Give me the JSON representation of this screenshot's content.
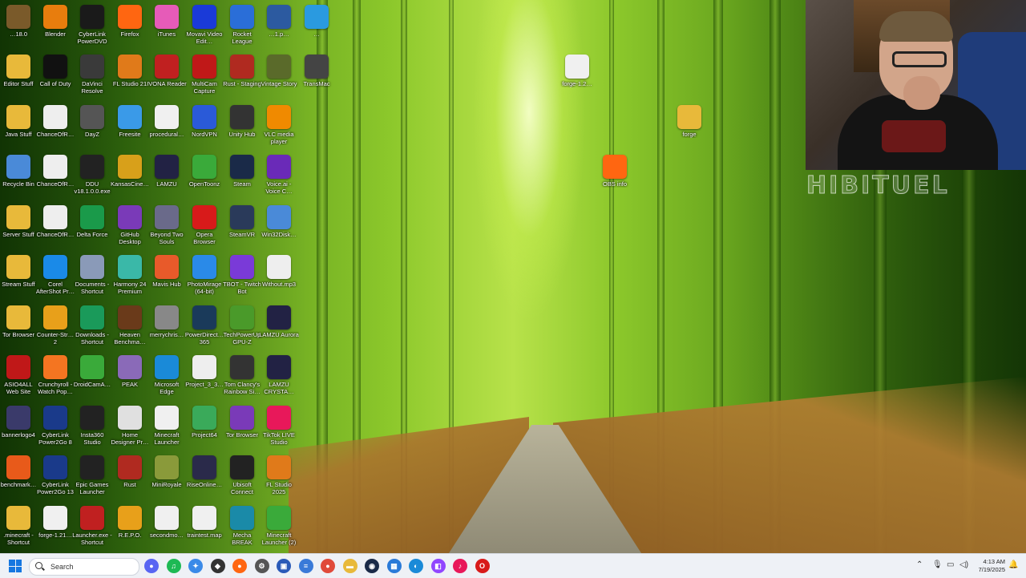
{
  "desktop_icons": [
    {
      "label": "…18.0",
      "icon": "app-icon",
      "color": "#7a5a2a"
    },
    {
      "label": "Blender",
      "icon": "blender-icon",
      "color": "#e87d0d"
    },
    {
      "label": "CyberLink PowerDVD",
      "icon": "powerdvd-icon",
      "color": "#1a1a1a"
    },
    {
      "label": "Firefox",
      "icon": "firefox-icon",
      "color": "#ff6611"
    },
    {
      "label": "iTunes",
      "icon": "itunes-icon",
      "color": "#e65bb8"
    },
    {
      "label": "Movavi Video Edit…",
      "icon": "movavi-icon",
      "color": "#1a3ad8"
    },
    {
      "label": "Rocket League",
      "icon": "rocket-league-icon",
      "color": "#2a6ed8"
    },
    {
      "label": "…1.p…",
      "icon": "document-icon",
      "color": "#2c5aa0"
    },
    {
      "label": "…",
      "icon": "app-icon",
      "color": "#2a9ae0"
    },
    {
      "label": "Editor Stuff",
      "icon": "folder-icon",
      "color": "#e8b93a"
    },
    {
      "label": "Call of Duty",
      "icon": "cod-icon",
      "color": "#111111"
    },
    {
      "label": "DaVinci Resolve",
      "icon": "davinci-icon",
      "color": "#3a3a3a"
    },
    {
      "label": "FL Studio 21",
      "icon": "fl-studio-icon",
      "color": "#e07a1a"
    },
    {
      "label": "IVONA Reader",
      "icon": "ivona-icon",
      "color": "#c02020"
    },
    {
      "label": "MultiCam Capture",
      "icon": "multicam-icon",
      "color": "#c01818"
    },
    {
      "label": "Rust - Staging",
      "icon": "rust-icon",
      "color": "#b02a20"
    },
    {
      "label": "Vintage Story",
      "icon": "vintage-story-icon",
      "color": "#5a6a2a"
    },
    {
      "label": "TransMac",
      "icon": "transmac-icon",
      "color": "#444444"
    },
    {
      "label": "Java Stuff",
      "icon": "folder-icon",
      "color": "#e8b93a"
    },
    {
      "label": "ChanceOfR…",
      "icon": "media-file-icon",
      "color": "#eeeeee"
    },
    {
      "label": "DayZ",
      "icon": "dayz-icon",
      "color": "#555555"
    },
    {
      "label": "Freesite",
      "icon": "freesite-icon",
      "color": "#3a9ae8"
    },
    {
      "label": "procedural…",
      "icon": "document-icon",
      "color": "#f0f0f0"
    },
    {
      "label": "NordVPN",
      "icon": "nordvpn-icon",
      "color": "#2a5ad8"
    },
    {
      "label": "Unity Hub",
      "icon": "unity-icon",
      "color": "#333333"
    },
    {
      "label": "VLC media player",
      "icon": "vlc-icon",
      "color": "#f08a00"
    },
    {
      "label": "Recycle Bin",
      "icon": "recycle-bin-icon",
      "color": "#4a8ad8"
    },
    {
      "label": "ChanceOfR…",
      "icon": "media-file-icon",
      "color": "#eeeeee"
    },
    {
      "label": "DDU v18.1.0.0.exe",
      "icon": "ddu-icon",
      "color": "#222222"
    },
    {
      "label": "KansasCine…",
      "icon": "app-icon",
      "color": "#d8a01a"
    },
    {
      "label": "LAMZU",
      "icon": "lamzu-icon",
      "color": "#222244"
    },
    {
      "label": "OpenToonz",
      "icon": "opentoonz-icon",
      "color": "#3aaa3a"
    },
    {
      "label": "Steam",
      "icon": "steam-icon",
      "color": "#1a2a48"
    },
    {
      "label": "Voice.ai - Voice C…",
      "icon": "voiceai-icon",
      "color": "#6a2ab8"
    },
    {
      "label": "Server Stuff",
      "icon": "folder-icon",
      "color": "#e8b93a"
    },
    {
      "label": "ChanceOfR…",
      "icon": "media-file-icon",
      "color": "#eeeeee"
    },
    {
      "label": "Delta Force",
      "icon": "delta-force-icon",
      "color": "#1a9a4a"
    },
    {
      "label": "GitHub Desktop",
      "icon": "github-icon",
      "color": "#7a3ab8"
    },
    {
      "label": "Beyond Two Souls",
      "icon": "game-icon",
      "color": "#6a6a8a"
    },
    {
      "label": "Opera Browser",
      "icon": "opera-icon",
      "color": "#d81a1a"
    },
    {
      "label": "SteamVR",
      "icon": "steamvr-icon",
      "color": "#2a3a5a"
    },
    {
      "label": "Win32Disk…",
      "icon": "win32disk-icon",
      "color": "#4a8ad8"
    },
    {
      "label": "Stream Stuff",
      "icon": "folder-icon",
      "color": "#e8b93a"
    },
    {
      "label": "Corel AfterShot Pr…",
      "icon": "aftershot-icon",
      "color": "#1a8ae8"
    },
    {
      "label": "Documents - Shortcut",
      "icon": "documents-icon",
      "color": "#8a9ab8"
    },
    {
      "label": "Harmony 24 Premium",
      "icon": "harmony-icon",
      "color": "#3ab8a8"
    },
    {
      "label": "Mavis Hub",
      "icon": "mavis-icon",
      "color": "#e85a2a"
    },
    {
      "label": "PhotoMirage (64-bit)",
      "icon": "photomirage-icon",
      "color": "#2a8ae8"
    },
    {
      "label": "TBOT - Twitch Bot",
      "icon": "tbot-icon",
      "color": "#7a3ad8"
    },
    {
      "label": "Without.mp3",
      "icon": "media-file-icon",
      "color": "#eeeeee"
    },
    {
      "label": "Tor Browser",
      "icon": "folder-icon",
      "color": "#e8b93a"
    },
    {
      "label": "Counter-Str… 2",
      "icon": "cs2-icon",
      "color": "#e8a01a"
    },
    {
      "label": "Downloads - Shortcut",
      "icon": "downloads-icon",
      "color": "#1a9a5a"
    },
    {
      "label": "Heaven Benchma…",
      "icon": "heaven-icon",
      "color": "#6a3a1a"
    },
    {
      "label": "merrychris…",
      "icon": "image-file-icon",
      "color": "#888888"
    },
    {
      "label": "PowerDirect… 365",
      "icon": "powerdirector-icon",
      "color": "#1a3a5a"
    },
    {
      "label": "TechPowerUp GPU-Z",
      "icon": "gpuz-icon",
      "color": "#4a9a2a"
    },
    {
      "label": "LAMZU Aurora",
      "icon": "lamzu-icon",
      "color": "#222244"
    },
    {
      "label": "ASIO4ALL Web Site",
      "icon": "asio-icon",
      "color": "#c01818"
    },
    {
      "label": "Crunchyroll - Watch Pop…",
      "icon": "crunchyroll-icon",
      "color": "#f47521"
    },
    {
      "label": "DroidCamA…",
      "icon": "droidcam-icon",
      "color": "#3aaa3a"
    },
    {
      "label": "PEAK",
      "icon": "peak-icon",
      "color": "#8a6ab8"
    },
    {
      "label": "Microsoft Edge",
      "icon": "edge-icon",
      "color": "#1a8ad8"
    },
    {
      "label": "Project_3_3…",
      "icon": "media-file-icon",
      "color": "#eeeeee"
    },
    {
      "label": "Tom Clancy's Rainbow Si…",
      "icon": "rainbow-six-icon",
      "color": "#333333"
    },
    {
      "label": "LAMZU CRYSTA…",
      "icon": "lamzu-icon",
      "color": "#222244"
    },
    {
      "label": "bannerlogo4",
      "icon": "image-file-icon",
      "color": "#3a3a6a"
    },
    {
      "label": "CyberLink Power2Go 8",
      "icon": "power2go-icon",
      "color": "#1a3a8a"
    },
    {
      "label": "Insta360 Studio",
      "icon": "insta360-icon",
      "color": "#222222"
    },
    {
      "label": "Home Designer Pr…",
      "icon": "home-designer-icon",
      "color": "#e0e0e0"
    },
    {
      "label": "Minecraft Launcher",
      "icon": "document-icon",
      "color": "#f0f0f0"
    },
    {
      "label": "Project64",
      "icon": "project64-icon",
      "color": "#3aaa5a"
    },
    {
      "label": "Tor Browser",
      "icon": "tor-icon",
      "color": "#7a3ab8"
    },
    {
      "label": "TikTok LIVE Studio",
      "icon": "tiktok-icon",
      "color": "#e8185a"
    },
    {
      "label": "benchmark…",
      "icon": "benchmark-icon",
      "color": "#e85a1a"
    },
    {
      "label": "CyberLink Power2Go 13",
      "icon": "power2go-icon",
      "color": "#1a3a8a"
    },
    {
      "label": "Epic Games Launcher",
      "icon": "epic-games-icon",
      "color": "#222222"
    },
    {
      "label": "Rust",
      "icon": "rust-icon",
      "color": "#b02a20"
    },
    {
      "label": "MiniRoyale",
      "icon": "miniroyale-icon",
      "color": "#8a9a3a"
    },
    {
      "label": "RiseOnline…",
      "icon": "riseonline-icon",
      "color": "#2a2a4a"
    },
    {
      "label": "Ubisoft Connect",
      "icon": "ubisoft-icon",
      "color": "#222222"
    },
    {
      "label": "FL Studio 2025",
      "icon": "fl-studio-icon",
      "color": "#e07a1a"
    },
    {
      "label": ".minecraft - Shortcut",
      "icon": "folder-icon",
      "color": "#e8b93a"
    },
    {
      "label": "forge-1.21…",
      "icon": "document-icon",
      "color": "#f0f0f0"
    },
    {
      "label": "Launcher.exe - Shortcut",
      "icon": "rust-edit-icon",
      "color": "#c02020"
    },
    {
      "label": "R.E.P.O.",
      "icon": "repo-icon",
      "color": "#e8a01a"
    },
    {
      "label": "secondmo…",
      "icon": "document-icon",
      "color": "#f0f0f0"
    },
    {
      "label": "traintest.map",
      "icon": "document-icon",
      "color": "#f0f0f0"
    },
    {
      "label": "Mecha BREAK",
      "icon": "mecha-break-icon",
      "color": "#1a8aa8"
    },
    {
      "label": "Minecraft Launcher (2)",
      "icon": "minecraft-icon",
      "color": "#3aaa3a"
    }
  ],
  "loose_icons": [
    {
      "label": "forge-1.2…",
      "icon": "java-icon",
      "color": "#f0f0f0"
    },
    {
      "label": "forge",
      "icon": "folder-icon",
      "color": "#e8b93a"
    },
    {
      "label": "OBS info",
      "icon": "firefox-icon",
      "color": "#ff6611"
    }
  ],
  "webcam": {
    "watermark": "HIBITUEL"
  },
  "taskbar": {
    "search_placeholder": "Search",
    "apps": [
      {
        "name": "discord-icon",
        "color": "#5865f2",
        "glyph": "●"
      },
      {
        "name": "spotify-icon",
        "color": "#1db954",
        "glyph": "♫"
      },
      {
        "name": "copilot-icon",
        "color": "#3a8ae8",
        "glyph": "✦"
      },
      {
        "name": "unity-icon",
        "color": "#333333",
        "glyph": "◆"
      },
      {
        "name": "firefox-icon",
        "color": "#ff6611",
        "glyph": "●"
      },
      {
        "name": "settings-icon",
        "color": "#555555",
        "glyph": "⚙"
      },
      {
        "name": "store-icon",
        "color": "#2a5ab8",
        "glyph": "▣"
      },
      {
        "name": "notepad-icon",
        "color": "#3a7ad8",
        "glyph": "≡"
      },
      {
        "name": "chrome-icon",
        "color": "#e04a3a",
        "glyph": "●"
      },
      {
        "name": "file-explorer-icon",
        "color": "#e8b93a",
        "glyph": "▬"
      },
      {
        "name": "steam-icon",
        "color": "#1a2a48",
        "glyph": "◉"
      },
      {
        "name": "app-icon",
        "color": "#2a7ad8",
        "glyph": "▦"
      },
      {
        "name": "edge-icon",
        "color": "#1a8ad8",
        "glyph": "◐"
      },
      {
        "name": "twitch-icon",
        "color": "#9146ff",
        "glyph": "◧"
      },
      {
        "name": "tiktok-icon",
        "color": "#e8185a",
        "glyph": "♪"
      },
      {
        "name": "opera-icon",
        "color": "#d81a1a",
        "glyph": "O"
      }
    ],
    "time": "4:13 AM",
    "date": "7/19/2025"
  }
}
